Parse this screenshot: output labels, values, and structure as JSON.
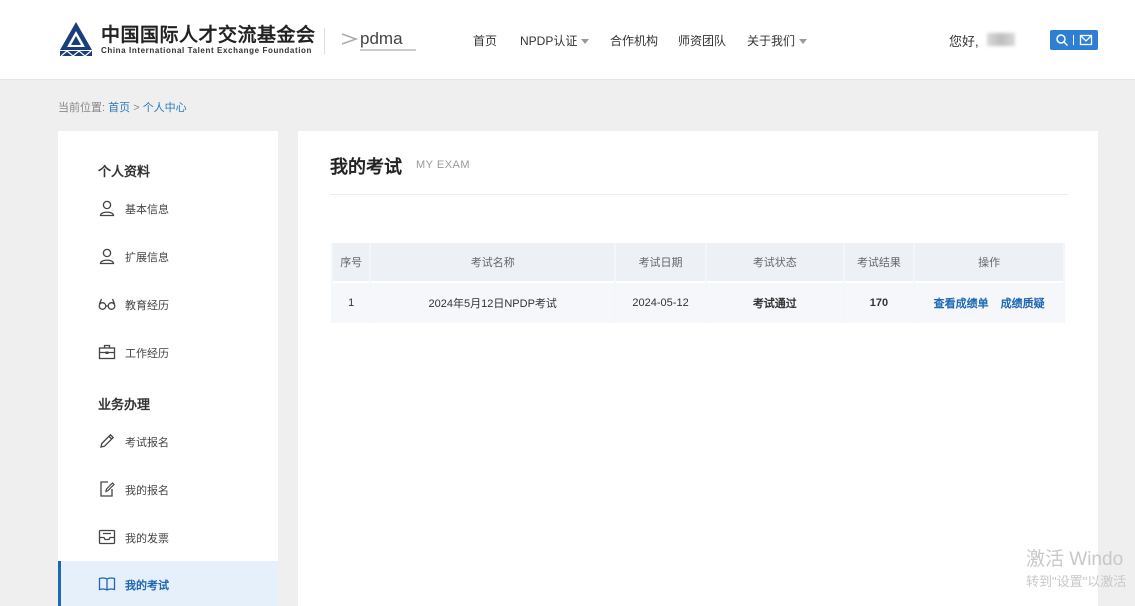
{
  "header": {
    "logo_cn": "中国国际人才交流基金会",
    "logo_en": "China International Talent Exchange Foundation",
    "partner": "pdma",
    "nav": [
      {
        "label": "首页",
        "dropdown": false
      },
      {
        "label": "NPDP认证",
        "dropdown": true
      },
      {
        "label": "合作机构",
        "dropdown": false
      },
      {
        "label": "师资团队",
        "dropdown": false
      },
      {
        "label": "关于我们",
        "dropdown": true
      }
    ],
    "greeting": "您好,",
    "accent": "#2e7fd4"
  },
  "breadcrumb": {
    "prefix": "当前位置:",
    "home": "首页",
    "sep": ">",
    "current": "个人中心"
  },
  "sidebar": {
    "section1": "个人资料",
    "section2": "业务办理",
    "items": [
      {
        "label": "基本信息",
        "icon": "user-icon"
      },
      {
        "label": "扩展信息",
        "icon": "user-icon"
      },
      {
        "label": "教育经历",
        "icon": "glasses-icon"
      },
      {
        "label": "工作经历",
        "icon": "briefcase-icon"
      },
      {
        "label": "考试报名",
        "icon": "pencil-icon"
      },
      {
        "label": "我的报名",
        "icon": "edit-doc-icon"
      },
      {
        "label": "我的发票",
        "icon": "inbox-icon"
      },
      {
        "label": "我的考试",
        "icon": "book-icon"
      }
    ]
  },
  "main": {
    "title": "我的考试",
    "subtitle": "MY EXAM",
    "columns": [
      "序号",
      "考试名称",
      "考试日期",
      "考试状态",
      "考试结果",
      "操作"
    ],
    "rows": [
      {
        "index": "1",
        "name": "2024年5月12日NPDP考试",
        "date": "2024-05-12",
        "status": "考试通过",
        "result": "170",
        "actions": [
          "查看成绩单",
          "成绩质疑"
        ]
      }
    ]
  },
  "watermark": {
    "line1": "激活 Windo",
    "line2": "转到\"设置\"以激活"
  }
}
